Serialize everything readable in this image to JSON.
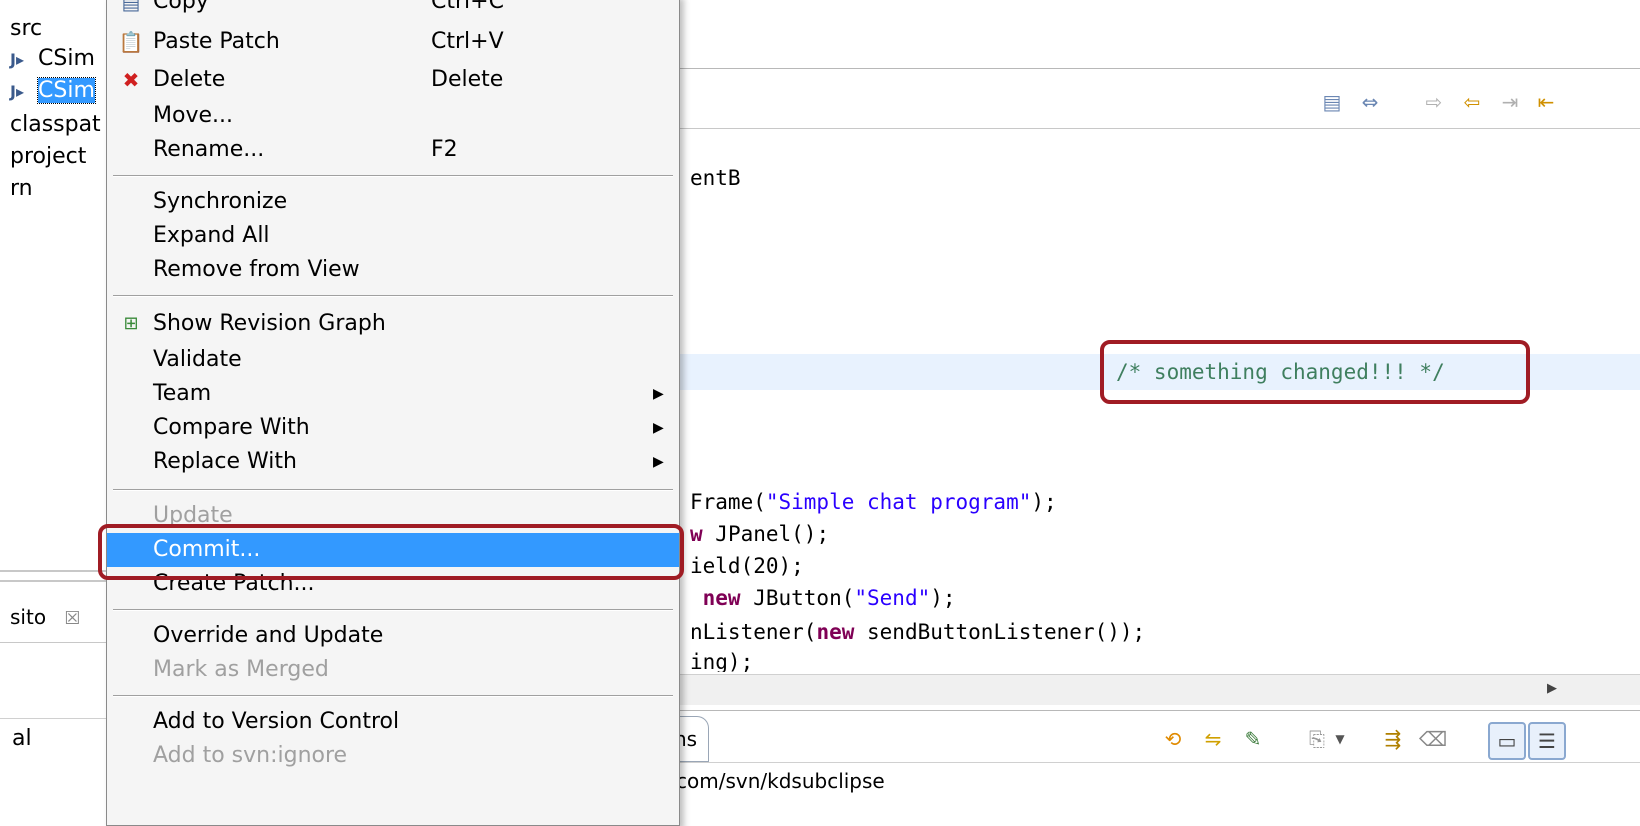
{
  "explorer": {
    "items": [
      {
        "label": "src"
      },
      {
        "label": "CSim"
      },
      {
        "label": "CSim"
      },
      {
        "label": "classpat"
      },
      {
        "label": "project"
      },
      {
        "label": "rn"
      }
    ]
  },
  "lower_view": {
    "tab_label": "sito",
    "close_glyph": "☒",
    "row_label": "al"
  },
  "editor": {
    "lines": [
      {
        "parts": [
          {
            "t": "entB",
            "c": ""
          }
        ]
      },
      {
        "parts": [
          {
            "t": "/* something changed!!! */",
            "c": "cmt"
          }
        ]
      },
      {
        "parts": [
          {
            "t": "Frame(",
            "c": ""
          },
          {
            "t": "\"Simple chat program\"",
            "c": "str"
          },
          {
            "t": ");",
            "c": ""
          }
        ]
      },
      {
        "parts": [
          {
            "t": "w",
            "c": "kw"
          },
          {
            "t": " JPanel();",
            "c": ""
          }
        ]
      },
      {
        "parts": [
          {
            "t": "ield(20);",
            "c": ""
          }
        ]
      },
      {
        "parts": [
          {
            "t": " new",
            "c": "kw"
          },
          {
            "t": " JButton(",
            "c": ""
          },
          {
            "t": "\"Send\"",
            "c": "str"
          },
          {
            "t": ");",
            "c": ""
          }
        ]
      },
      {
        "parts": [
          {
            "t": "nListener(",
            "c": ""
          },
          {
            "t": "new",
            "c": "kw"
          },
          {
            "t": " sendButtonListener());",
            "c": ""
          }
        ]
      },
      {
        "parts": [
          {
            "t": "ing);",
            "c": ""
          }
        ]
      }
    ]
  },
  "bottom": {
    "tab_partial": "ns",
    "url_partial": "com/svn/kdsubclipse"
  },
  "menu": {
    "items": [
      {
        "label": "Copy",
        "accel": "Ctrl+C",
        "icon": "copy-icon"
      },
      {
        "label": "Paste Patch",
        "accel": "Ctrl+V",
        "icon": "paste-icon"
      },
      {
        "label": "Delete",
        "accel": "Delete",
        "icon": "delete-icon"
      },
      {
        "label": "Move...",
        "accel": ""
      },
      {
        "label": "Rename...",
        "accel": "F2"
      },
      {
        "label": "Synchronize"
      },
      {
        "label": "Expand All"
      },
      {
        "label": "Remove from View"
      },
      {
        "label": "Show Revision Graph",
        "icon": "revision-graph-icon"
      },
      {
        "label": "Validate"
      },
      {
        "label": "Team"
      },
      {
        "label": "Compare With"
      },
      {
        "label": "Replace With"
      },
      {
        "label": "Update",
        "disabled": true
      },
      {
        "label": "Commit...",
        "active": true
      },
      {
        "label": "Create Patch..."
      },
      {
        "label": "Override and Update"
      },
      {
        "label": "Mark as Merged",
        "disabled": true
      },
      {
        "label": "Add to Version Control"
      },
      {
        "label": "Add to svn:ignore",
        "disabled": true
      }
    ],
    "submenu_arrow": "▶"
  },
  "colors": {
    "highlight": "#3399ff",
    "annotation": "#a01c24",
    "comment": "#3f7f5f",
    "keyword": "#7f0055",
    "string": "#2a00ff"
  }
}
